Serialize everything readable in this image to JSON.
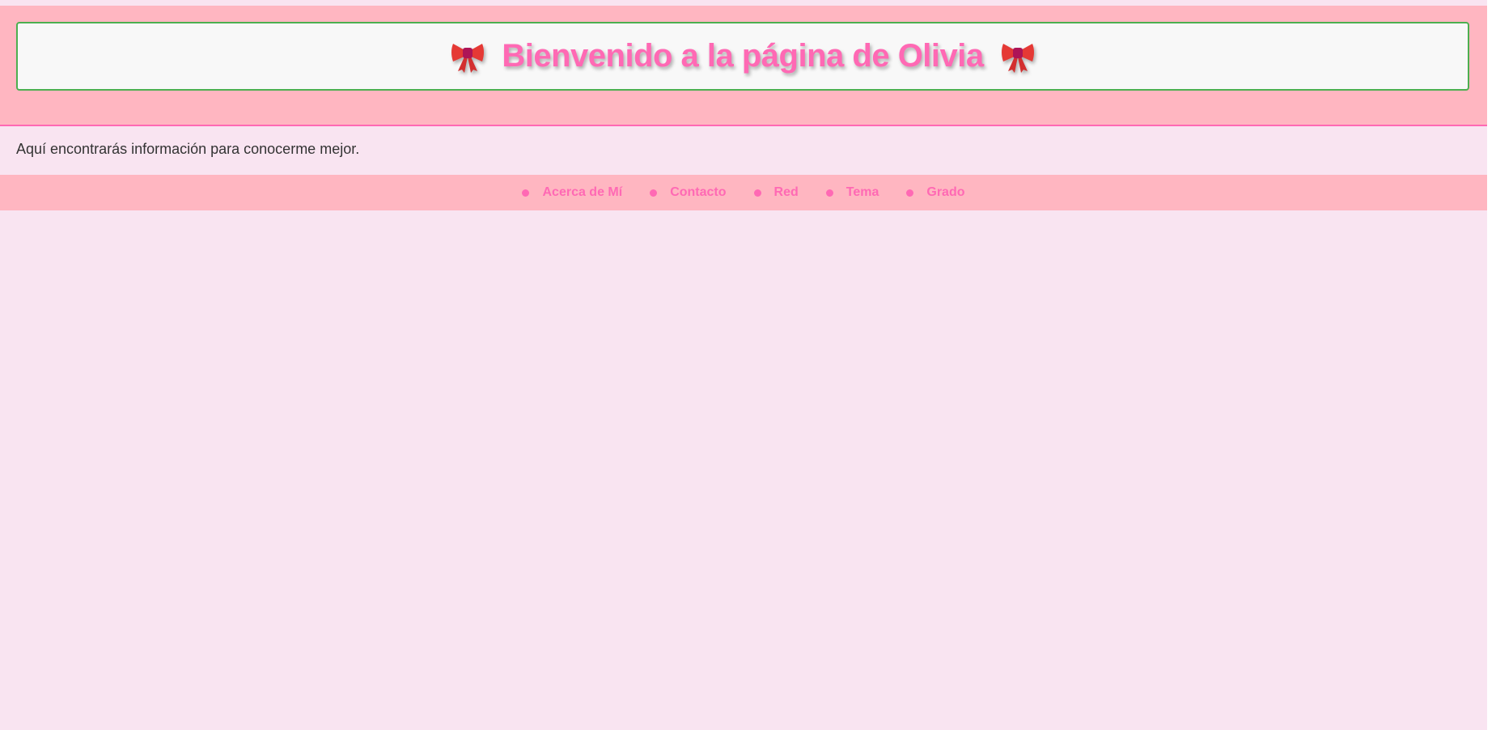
{
  "header": {
    "title": "Bienvenido a la página de Olivia",
    "left_icon": "bow-icon",
    "right_icon": "bow-icon"
  },
  "intro": {
    "text": "Aquí encontrarás información para conocerme mejor."
  },
  "nav": {
    "items": [
      {
        "label": "Acerca de Mí"
      },
      {
        "label": "Contacto"
      },
      {
        "label": "Red"
      },
      {
        "label": "Tema"
      },
      {
        "label": "Grado"
      }
    ]
  },
  "colors": {
    "page_bg": "#f9e4f1",
    "header_bg": "#ffb6c1",
    "accent": "#ff69b4",
    "title_box_bg": "#f8f8f8",
    "title_box_border": "#4caf50",
    "text": "#333333"
  }
}
